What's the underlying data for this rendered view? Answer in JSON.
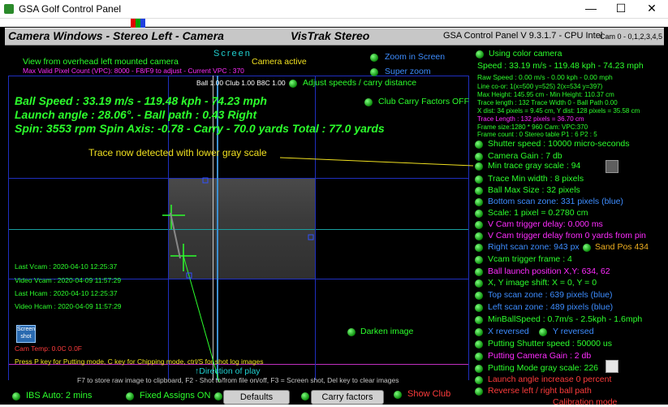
{
  "window": {
    "title": "GSA Golf Control Panel",
    "minimize": "—",
    "maximize": "☐",
    "close": "✕"
  },
  "panelbar": {
    "left_title": "Camera Windows - Stereo Left - Camera",
    "center_title": "VisTrak Stereo",
    "right_title": "GSA Control Panel  V 9.3.1.7 - CPU Intel",
    "cam_label": "Cam 0 - 0,1,2,3,4,5"
  },
  "camera": {
    "screen_label": "Screen",
    "view_label": "View from overhead left mounted camera",
    "camera_active": "Camera active",
    "pixel_count": "Max Valid Pixel Count (VPC): 8000  - F8/F9 to adjust - Current VPC : 370",
    "ball_club": "Ball 1.00 Club 1.00 B8C 1.00",
    "ball_speed": "Ball Speed : 33.19 m/s - 119.48 kph - 74.23 mph",
    "launch_angle": "Launch angle : 28.06°. - Ball path : 0.43 Right",
    "spin": "Spin: 3553 rpm  Spin Axis: -0.78 - Carry - 70.0 yards  Total : 77.0 yards",
    "annotation": "Trace now detected with lower gray scale",
    "last_vcam": "Last Vcam : 2020-04-10 12:25:37",
    "video_vcam": "Video Vcam : 2020-04-09 11:57:29",
    "last_hcam": "Last Hcam : 2020-04-10 12:25:37",
    "video_hcam": "Video Hcam : 2020-04-09 11:57:29",
    "screenshot_btn": "Screen shot",
    "cam_temp": "Cam Temp: 0.0C 0.0F",
    "direction": "Direction of play",
    "help1": "Press P key for Putting mode, C key for Chipping mode, ctrl/S for shot log images",
    "help2": "F7 to store raw image to clipboard, F2 - Shot to/from file on/off, F3 = Screen shot, Del key to clear images"
  },
  "options": {
    "zoom_in_screen": "Zoom in Screen",
    "super_zoom": "Super zoom",
    "adjust_speeds": "Adjust speeds / carry distance",
    "club_carry": "Club Carry Factors OFF",
    "darken_image": "Darken image"
  },
  "right": {
    "using_color": "Using color camera",
    "speed": "Speed : 33.19 m/s - 119.48 kph - 74.23 mph",
    "raw_speed": "Raw Speed : 0.00 m/s - 0.00 kph - 0.00 mph",
    "info_lines": [
      "Line co-or: 1(x=500 y=525) 2(x=534 y=397)",
      "Max Height: 145.95 cm - Min Height: 110.37 cm",
      "Trace length : 132 Trace Width 0 - Ball Path 0.00",
      "X dist: 34 pixels = 9.45 cm, Y dist: 128 pixels = 35.58 cm",
      "Trace Length : 132 pixels = 36.70 cm",
      "Frame size:1280 * 960 Cam:  VPC:370",
      "Frame count : 0        Stereo table P1 : 6 P2 : 5"
    ],
    "settings": [
      {
        "label": "Shutter speed : 10000 micro-seconds",
        "color": "#2cff2c"
      },
      {
        "label": "Camera Gain : 7 db",
        "color": "#2cff2c"
      },
      {
        "label": "Min trace gray scale : 94",
        "color": "#2cff2c"
      },
      {
        "label": "Trace Min width : 8 pixels",
        "color": "#2cff2c"
      },
      {
        "label": "Ball Max Size : 32 pixels",
        "color": "#2cff2c"
      },
      {
        "label": "Bottom scan zone: 331 pixels (blue)",
        "color": "#3d8dff"
      },
      {
        "label": "Scale: 1 pixel = 0.2780 cm",
        "color": "#2cff2c"
      },
      {
        "label": "V Cam trigger delay: 0.000 ms",
        "color": "#ff2cff"
      },
      {
        "label": "V Cam trigger delay from 0 yards from pin",
        "color": "#ff2cff"
      },
      {
        "label": "Right scan zone: 943 px",
        "color": "#3d8dff"
      },
      {
        "label": "Vcam trigger frame : 4",
        "color": "#2cff2c"
      },
      {
        "label": "Ball launch position X,Y: 634, 62",
        "color": "#ff2cff"
      },
      {
        "label": "X, Y image shift: X = 0, Y = 0",
        "color": "#2cff2c"
      },
      {
        "label": "Top scan zone : 639 pixels (blue)",
        "color": "#3d8dff"
      },
      {
        "label": "Left scan zone : 489 pixels (blue)",
        "color": "#3d8dff"
      },
      {
        "label": "MinBallSpeed : 0.7m/s - 2.5kph - 1.6mph",
        "color": "#2cff2c"
      },
      {
        "label": "X reversed",
        "color": "#3d8dff"
      },
      {
        "label": "Putting Shutter speed : 50000 us",
        "color": "#2cff2c"
      },
      {
        "label": "Putting Camera Gain : 2 db",
        "color": "#ff2cff"
      },
      {
        "label": "Putting Mode gray scale: 226",
        "color": "#2cff2c"
      },
      {
        "label": "Launch angle increase 0 percent",
        "color": "#ff3c3c"
      },
      {
        "label": "Reverse left / right ball path",
        "color": "#ff3c3c"
      }
    ],
    "sand_pos": "Sand Pos 434",
    "y_reversed": "Y reversed",
    "calibration_mode": "Calibration mode"
  },
  "bottom": {
    "ibs_auto": "IBS Auto: 2 mins",
    "fixed_assigns": "Fixed Assigns ON",
    "defaults": "Defaults",
    "carry_factors": "Carry factors",
    "show_club": "Show Club"
  },
  "colors": {
    "green": "#2cff2c",
    "yellow": "#f0e020",
    "magenta": "#ff2cff",
    "blue": "#3d8dff",
    "red": "#ff3c3c",
    "gridblue": "#1f2fbf",
    "cyan": "#20d0d0"
  }
}
